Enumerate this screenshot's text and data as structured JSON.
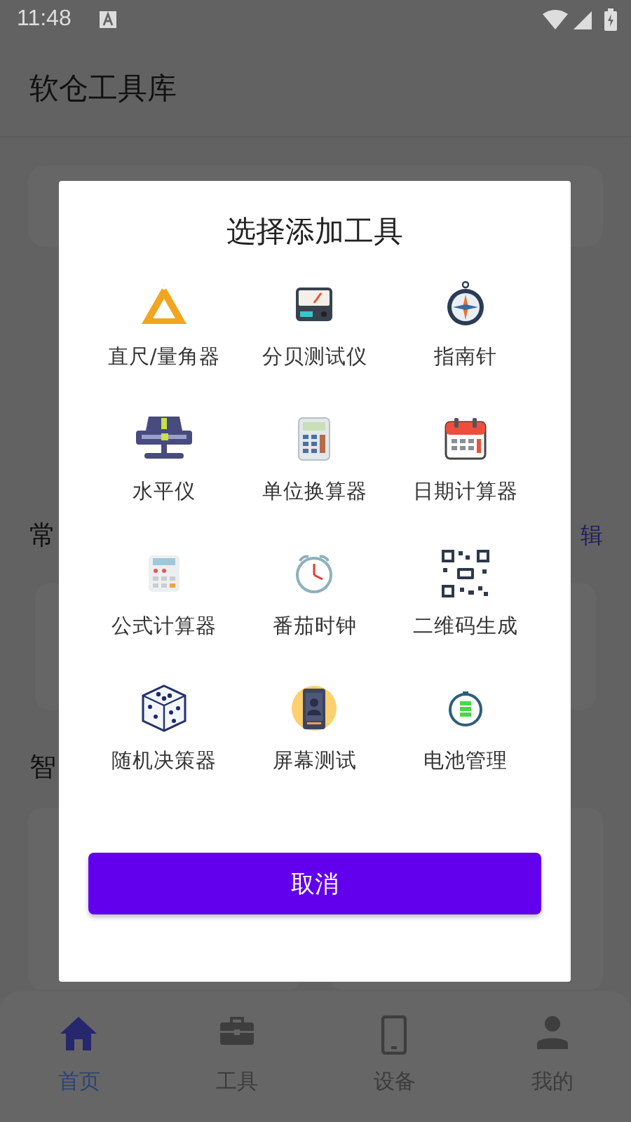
{
  "status_bar": {
    "time": "11:48"
  },
  "app_bar": {
    "title": "软仓工具库"
  },
  "background": {
    "section_1_title": "常",
    "section_1_action": "辑",
    "section_2_title": "智"
  },
  "dialog": {
    "title": "选择添加工具",
    "tools": [
      {
        "label": "直尺/量角器",
        "kind": "ruler"
      },
      {
        "label": "分贝测试仪",
        "kind": "meter"
      },
      {
        "label": "指南针",
        "kind": "compass"
      },
      {
        "label": "水平仪",
        "kind": "level"
      },
      {
        "label": "单位换算器",
        "kind": "converter"
      },
      {
        "label": "日期计算器",
        "kind": "calendar"
      },
      {
        "label": "公式计算器",
        "kind": "calculator"
      },
      {
        "label": "番茄时钟",
        "kind": "clock"
      },
      {
        "label": "二维码生成",
        "kind": "qr"
      },
      {
        "label": "随机决策器",
        "kind": "dice"
      },
      {
        "label": "屏幕测试",
        "kind": "screen"
      },
      {
        "label": "电池管理",
        "kind": "battery"
      }
    ],
    "cancel": "取消"
  },
  "bottom_nav": [
    {
      "label": "首页",
      "kind": "home",
      "selected": true
    },
    {
      "label": "工具",
      "kind": "tools",
      "selected": false
    },
    {
      "label": "设备",
      "kind": "device",
      "selected": false
    },
    {
      "label": "我的",
      "kind": "profile",
      "selected": false
    }
  ]
}
